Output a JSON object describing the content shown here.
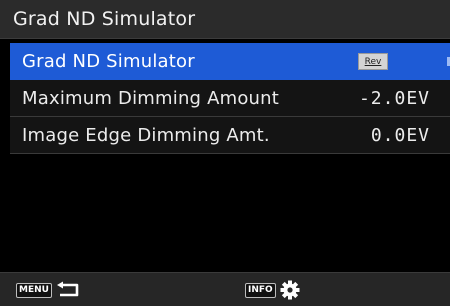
{
  "screen_title": "Grad ND Simulator",
  "menu_items": [
    {
      "label": "Grad ND Simulator",
      "value": "",
      "badge": "Rev",
      "selected": true
    },
    {
      "label": "Maximum Dimming Amount",
      "value": "-2.0EV",
      "selected": false
    },
    {
      "label": "Image Edge Dimming Amt.",
      "value": "0.0EV",
      "selected": false
    }
  ],
  "footer": {
    "menu_button": "MENU",
    "menu_icon": "return-arrow-icon",
    "info_button": "INFO",
    "info_icon": "gear-icon"
  },
  "colors": {
    "selection_highlight": "#1e5bd6",
    "title_bar": "#2b2b2b",
    "background": "#000000",
    "footer": "#262626"
  }
}
